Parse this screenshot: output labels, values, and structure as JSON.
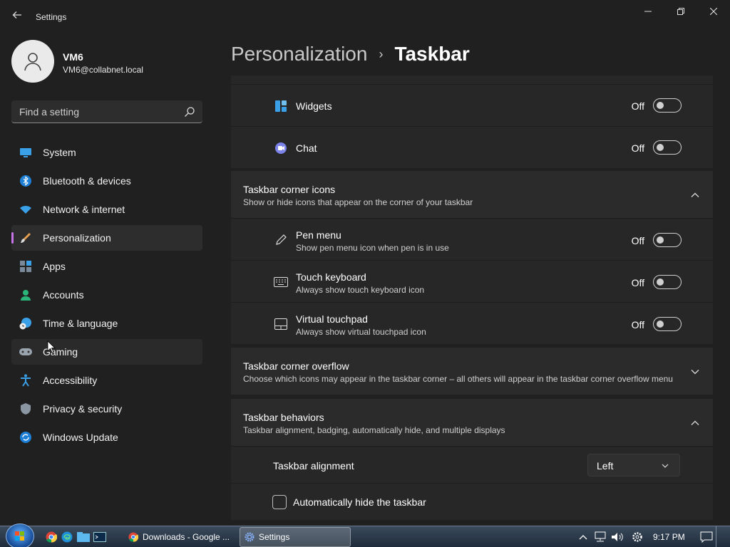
{
  "window": {
    "title": "Settings"
  },
  "profile": {
    "name": "VM6",
    "email": "VM6@collabnet.local"
  },
  "search": {
    "placeholder": "Find a setting"
  },
  "sidebar": {
    "items": [
      {
        "label": "System",
        "icon": "monitor-icon"
      },
      {
        "label": "Bluetooth & devices",
        "icon": "bluetooth-icon"
      },
      {
        "label": "Network & internet",
        "icon": "wifi-icon"
      },
      {
        "label": "Personalization",
        "icon": "brush-icon",
        "active": true
      },
      {
        "label": "Apps",
        "icon": "apps-icon"
      },
      {
        "label": "Accounts",
        "icon": "person-icon"
      },
      {
        "label": "Time & language",
        "icon": "globe-clock-icon"
      },
      {
        "label": "Gaming",
        "icon": "gamepad-icon",
        "hover": true
      },
      {
        "label": "Accessibility",
        "icon": "accessibility-icon"
      },
      {
        "label": "Privacy & security",
        "icon": "shield-icon"
      },
      {
        "label": "Windows Update",
        "icon": "update-icon"
      }
    ]
  },
  "breadcrumb": {
    "parent": "Personalization",
    "separator": "›",
    "current": "Taskbar"
  },
  "taskbar_items": {
    "widgets": {
      "label": "Widgets",
      "state": "Off"
    },
    "chat": {
      "label": "Chat",
      "state": "Off"
    }
  },
  "corner_icons": {
    "title": "Taskbar corner icons",
    "subtitle": "Show or hide icons that appear on the corner of your taskbar",
    "items": [
      {
        "label": "Pen menu",
        "desc": "Show pen menu icon when pen is in use",
        "state": "Off"
      },
      {
        "label": "Touch keyboard",
        "desc": "Always show touch keyboard icon",
        "state": "Off"
      },
      {
        "label": "Virtual touchpad",
        "desc": "Always show virtual touchpad icon",
        "state": "Off"
      }
    ]
  },
  "corner_overflow": {
    "title": "Taskbar corner overflow",
    "subtitle": "Choose which icons may appear in the taskbar corner – all others will appear in the taskbar corner overflow menu"
  },
  "behaviors": {
    "title": "Taskbar behaviors",
    "subtitle": "Taskbar alignment, badging, automatically hide, and multiple displays",
    "alignment_label": "Taskbar alignment",
    "alignment_value": "Left",
    "autohide_label": "Automatically hide the taskbar"
  },
  "os_taskbar": {
    "windows": [
      {
        "label": "Downloads - Google ..."
      },
      {
        "label": "Settings"
      }
    ],
    "clock": "9:17 PM"
  },
  "colors": {
    "accent": "#c774e8",
    "background": "#202020",
    "card": "#2b2b2b"
  }
}
